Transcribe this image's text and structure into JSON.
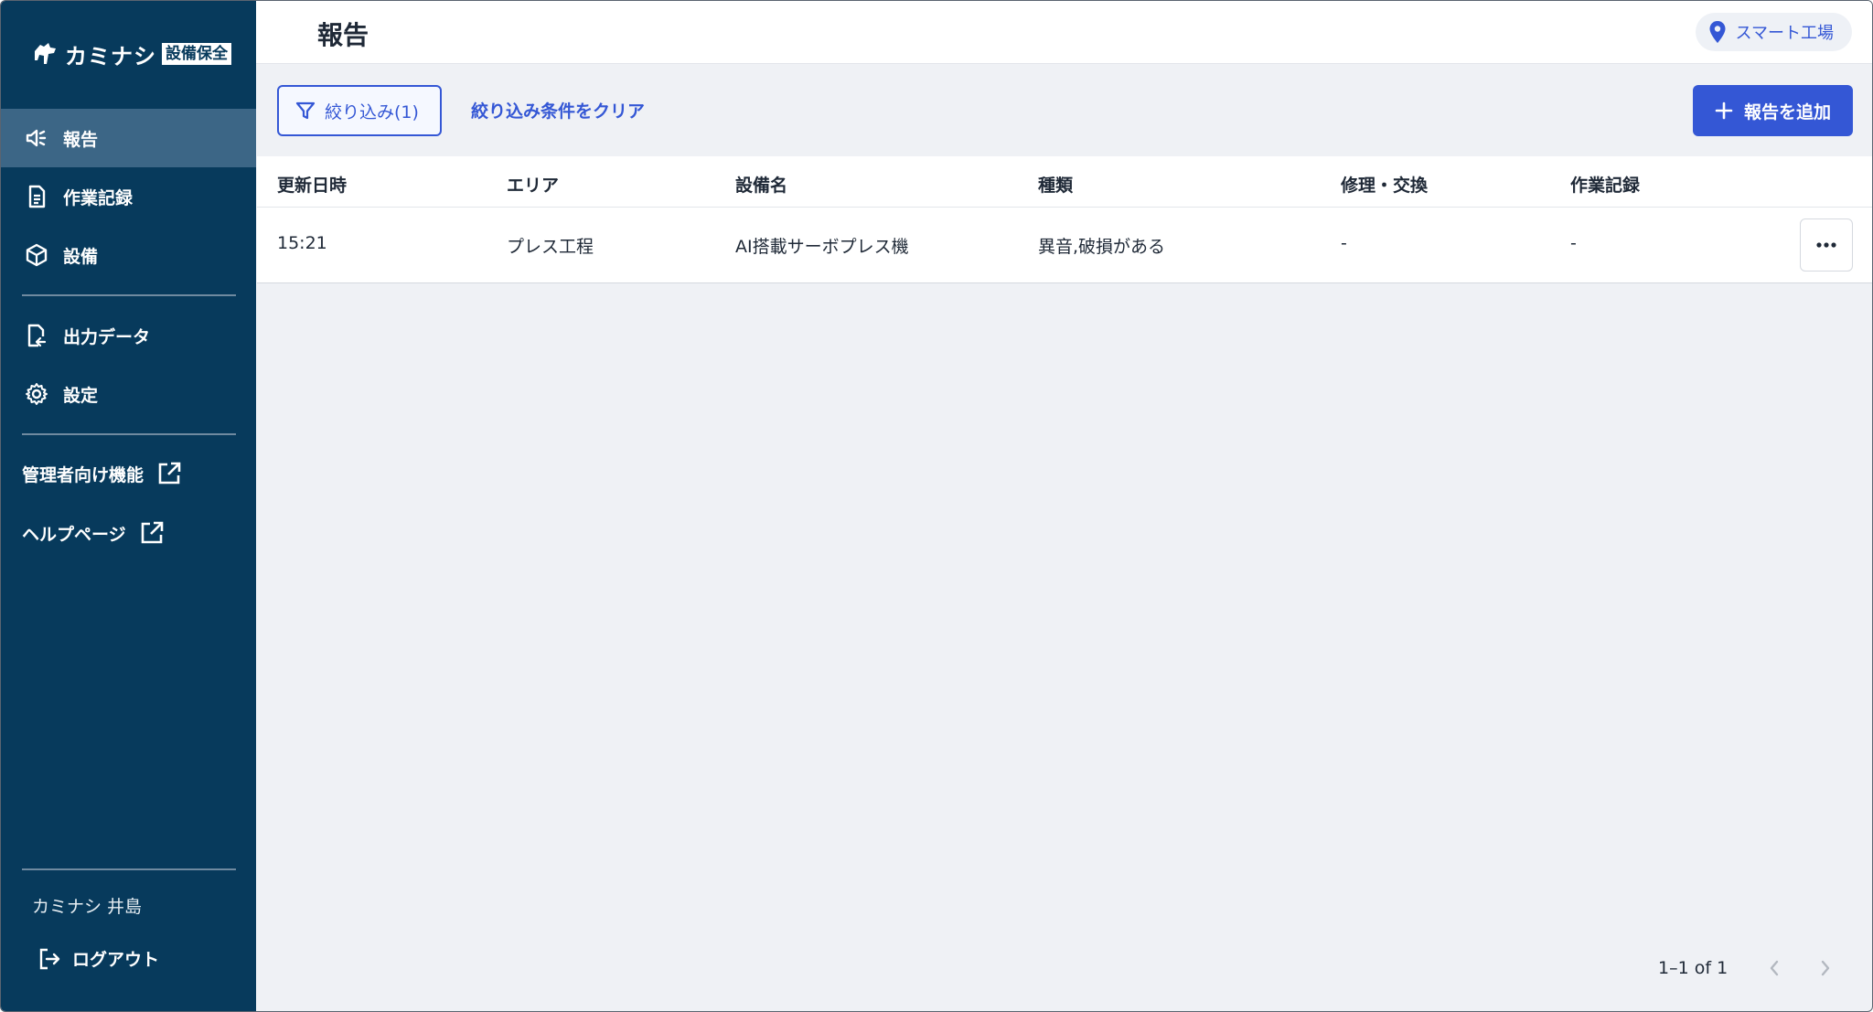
{
  "sidebar": {
    "logo_text": "カミナシ",
    "logo_tag": "設備保全",
    "nav": [
      {
        "label": "報告",
        "icon": "megaphone-icon",
        "active": true
      },
      {
        "label": "作業記録",
        "icon": "document-icon"
      },
      {
        "label": "設備",
        "icon": "cube-icon"
      },
      {
        "label": "出力データ",
        "icon": "file-export-icon"
      },
      {
        "label": "設定",
        "icon": "gear-icon"
      }
    ],
    "external": [
      {
        "label": "管理者向け機能",
        "icon": "external-link-icon"
      },
      {
        "label": "ヘルプページ",
        "icon": "external-link-icon"
      }
    ],
    "user_name": "カミナシ 井島",
    "logout_label": "ログアウト"
  },
  "header": {
    "title": "報告",
    "location": "スマート工場"
  },
  "toolbar": {
    "filter_label": "絞り込み(1)",
    "clear_label": "絞り込み条件をクリア",
    "add_label": "報告を追加"
  },
  "table": {
    "columns": [
      "更新日時",
      "エリア",
      "設備名",
      "種類",
      "修理・交換",
      "作業記録"
    ],
    "rows": [
      [
        "15:21",
        "プレス工程",
        "AI搭載サーボプレス機",
        "異音,破損がある",
        "-",
        "-"
      ]
    ]
  },
  "pagination": {
    "text": "1–1 of 1"
  },
  "colors": {
    "sidebar": "#073a5c",
    "sidebar_active": "#3c6686",
    "accent": "#3457d5",
    "background": "#eff1f5"
  }
}
